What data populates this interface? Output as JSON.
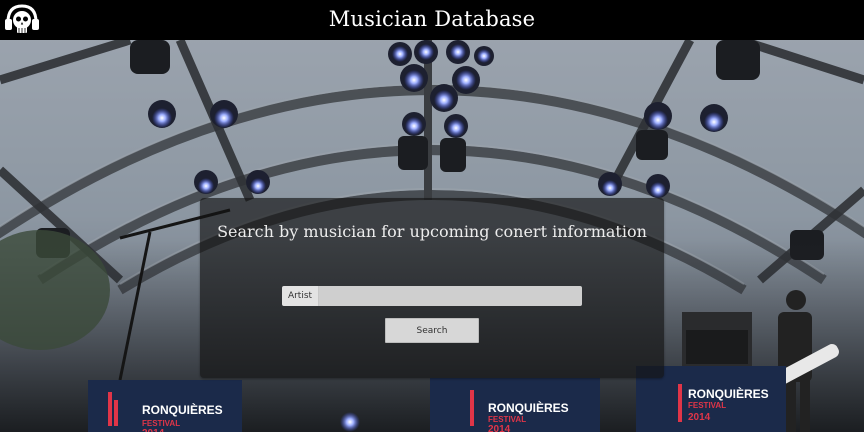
{
  "header": {
    "title": "Musician Database",
    "logo_icon": "skull-headphones-icon"
  },
  "search": {
    "heading": "Search by musician for upcoming conert information",
    "artist_label": "Artist",
    "artist_value": "",
    "artist_placeholder": "",
    "button_label": "Search"
  },
  "background": {
    "banner_text_1": "RONQUIÈRES",
    "banner_text_2": "FESTIVAL",
    "banner_text_3": "2014"
  },
  "colors": {
    "header_bg": "#000000",
    "card_bg": "rgba(20,20,20,0.66)",
    "stage_light": "#5a72ff",
    "banner_red": "#e03548",
    "banner_navy": "#1b2a4a"
  }
}
